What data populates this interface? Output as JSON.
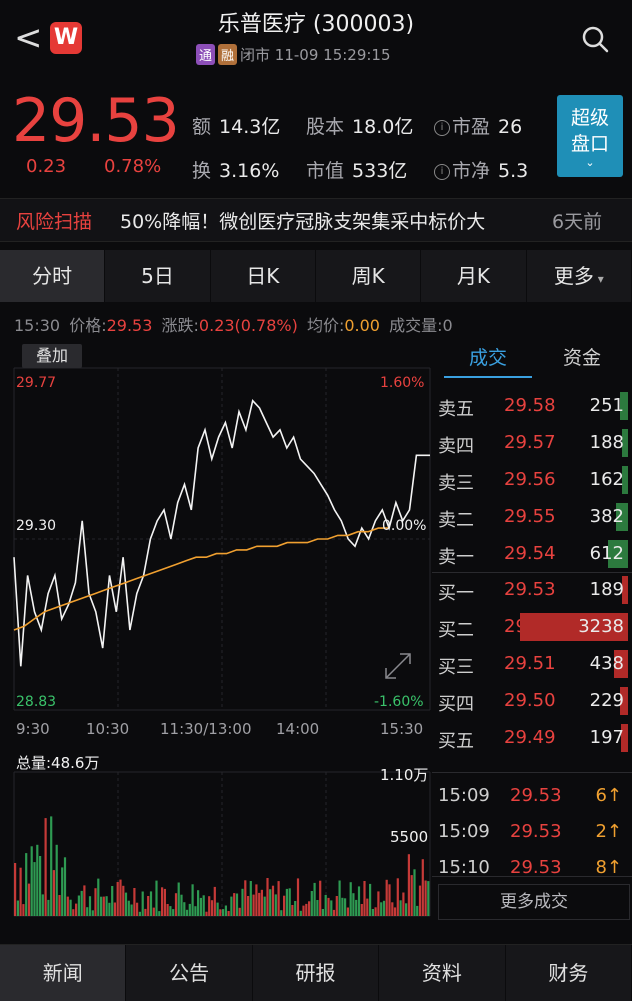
{
  "header": {
    "back": "<",
    "logo": "W",
    "title": "乐普医疗 (300003)",
    "tags": [
      "通",
      "融"
    ],
    "status": "闭市 11-09 15:29:15"
  },
  "quote": {
    "price": "29.53",
    "change": "0.23",
    "change_pct": "0.78%",
    "stats": [
      {
        "k": "额",
        "v": "14.3亿"
      },
      {
        "k": "股本",
        "v": "18.0亿"
      },
      {
        "k": "市盈",
        "v": "26"
      },
      {
        "k": "换",
        "v": "3.16%"
      },
      {
        "k": "市值",
        "v": "533亿"
      },
      {
        "k": "市净",
        "v": "5.3"
      }
    ],
    "super_btn": [
      "超级",
      "盘口"
    ]
  },
  "risk": {
    "label": "风险扫描",
    "text": "50%降幅！微创医疗冠脉支架集采中标价大",
    "time": "6天前"
  },
  "tabs": [
    "分时",
    "5日",
    "日K",
    "周K",
    "月K",
    "更多"
  ],
  "status_line": {
    "time": "15:30",
    "price_k": "价格:",
    "price_v": "29.53",
    "chg_k": "涨跌:",
    "chg_v": "0.23(0.78%)",
    "avg_k": "均价:",
    "avg_v": "0.00",
    "vol_k": "成交量:",
    "vol_v": "0"
  },
  "chart": {
    "overlay": "叠加",
    "y_top": "29.77",
    "y_mid": "29.30",
    "y_bot": "28.83",
    "pct_top": "1.60%",
    "pct_mid": "0.00%",
    "pct_bot": "-1.60%",
    "x_labels": [
      "9:30",
      "10:30",
      "11:30/13:00",
      "14:00",
      "15:30"
    ],
    "vol_label": "总量:48.6万",
    "vol_top": "1.10万",
    "vol_mid": "5500"
  },
  "chart_data": {
    "type": "line",
    "ylim": [
      28.83,
      29.77
    ],
    "prev_close": 29.3,
    "series": [
      {
        "values": [
          29.25,
          28.95,
          29.2,
          29.1,
          29.05,
          29.15,
          29.2,
          29.08,
          29.12,
          29.18,
          29.35,
          29.15,
          29.1,
          29.0,
          29.2,
          29.1,
          29.25,
          29.05,
          29.15,
          29.2,
          29.3,
          29.35,
          29.38,
          29.3,
          29.4,
          29.45,
          29.38,
          29.55,
          29.6,
          29.52,
          29.58,
          29.62,
          29.55,
          29.65,
          29.6,
          29.68,
          29.66,
          29.62,
          29.58,
          29.6,
          29.55,
          29.58,
          29.52,
          29.5,
          29.48,
          29.45,
          29.42,
          29.38,
          29.35,
          29.3,
          29.28,
          29.33,
          29.3,
          29.35,
          29.38,
          29.33,
          29.4,
          29.35,
          29.38,
          29.53,
          29.53,
          29.53
        ]
      },
      {
        "values": [
          29.05,
          29.06,
          29.08,
          29.1,
          29.11,
          29.12,
          29.13,
          29.14,
          29.15,
          29.16,
          29.17,
          29.18,
          29.19,
          29.2,
          29.21,
          29.22,
          29.23,
          29.24,
          29.25,
          29.25,
          29.26,
          29.26,
          29.27,
          29.27,
          29.28,
          29.28,
          29.28,
          29.29,
          29.29,
          29.29,
          29.3,
          29.3,
          29.31,
          29.31,
          29.32,
          29.32,
          29.33,
          29.33
        ]
      }
    ]
  },
  "orderbook": {
    "tabs": [
      "成交",
      "资金"
    ],
    "asks": [
      {
        "label": "卖五",
        "price": "29.58",
        "vol": "251",
        "w": 0.07
      },
      {
        "label": "卖四",
        "price": "29.57",
        "vol": "188",
        "w": 0.05
      },
      {
        "label": "卖三",
        "price": "29.56",
        "vol": "162",
        "w": 0.045
      },
      {
        "label": "卖二",
        "price": "29.55",
        "vol": "382",
        "w": 0.1
      },
      {
        "label": "卖一",
        "price": "29.54",
        "vol": "612",
        "w": 0.17
      }
    ],
    "bids": [
      {
        "label": "买一",
        "price": "29.53",
        "vol": "189",
        "w": 0.05
      },
      {
        "label": "买二",
        "price": "29.52",
        "vol": "3238",
        "w": 0.9
      },
      {
        "label": "买三",
        "price": "29.51",
        "vol": "438",
        "w": 0.12
      },
      {
        "label": "买四",
        "price": "29.50",
        "vol": "229",
        "w": 0.065
      },
      {
        "label": "买五",
        "price": "29.49",
        "vol": "197",
        "w": 0.055
      }
    ],
    "trades": [
      {
        "t": "15:09",
        "p": "29.53",
        "v": "6↑"
      },
      {
        "t": "15:09",
        "p": "29.53",
        "v": "2↑"
      },
      {
        "t": "15:10",
        "p": "29.53",
        "v": "8↑"
      }
    ],
    "more": "更多成交"
  },
  "bottom_nav": [
    "新闻",
    "公告",
    "研报",
    "资料",
    "财务"
  ],
  "colors": {
    "up": "#e8423f",
    "down": "#3ac26a",
    "accent": "#1f8fb7",
    "avg_line": "#f0a030"
  }
}
